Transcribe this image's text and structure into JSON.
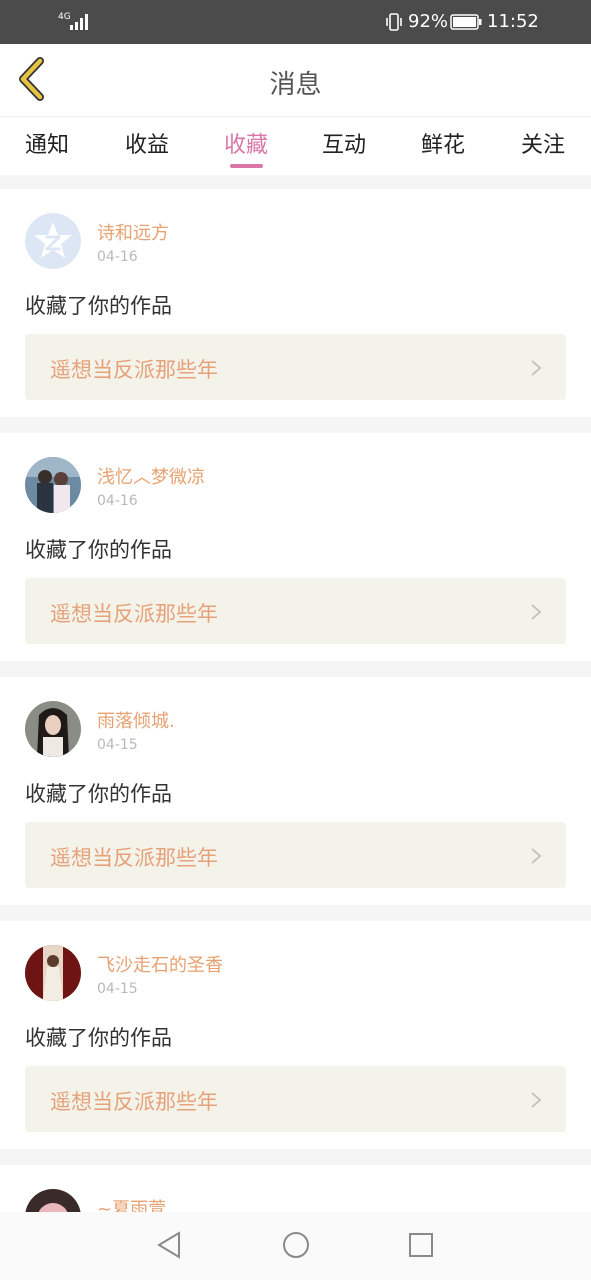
{
  "status_bar": {
    "network": "4G",
    "battery": "92%",
    "time": "11:52"
  },
  "header": {
    "title": "消息",
    "back_icon": "chevron-left-icon"
  },
  "tabs": [
    {
      "label": "通知",
      "active": false
    },
    {
      "label": "收益",
      "active": false
    },
    {
      "label": "收藏",
      "active": true
    },
    {
      "label": "互动",
      "active": false
    },
    {
      "label": "鲜花",
      "active": false
    },
    {
      "label": "关注",
      "active": false
    }
  ],
  "messages": [
    {
      "username": "诗和远方",
      "date": "04-16",
      "action": "收藏了你的作品",
      "work": "遥想当反派那些年"
    },
    {
      "username": "浅忆︿梦微凉",
      "date": "04-16",
      "action": "收藏了你的作品",
      "work": "遥想当反派那些年"
    },
    {
      "username": "雨落倾城.",
      "date": "04-15",
      "action": "收藏了你的作品",
      "work": "遥想当反派那些年"
    },
    {
      "username": "飞沙走石的圣香",
      "date": "04-15",
      "action": "收藏了你的作品",
      "work": "遥想当反派那些年"
    },
    {
      "username": "~夏雨萱",
      "date": "",
      "action": "",
      "work": ""
    }
  ],
  "colors": {
    "accent": "#d977a8",
    "username": "#e8a171",
    "work_bg": "#f4f3ea",
    "back_icon": "#e5c441"
  }
}
